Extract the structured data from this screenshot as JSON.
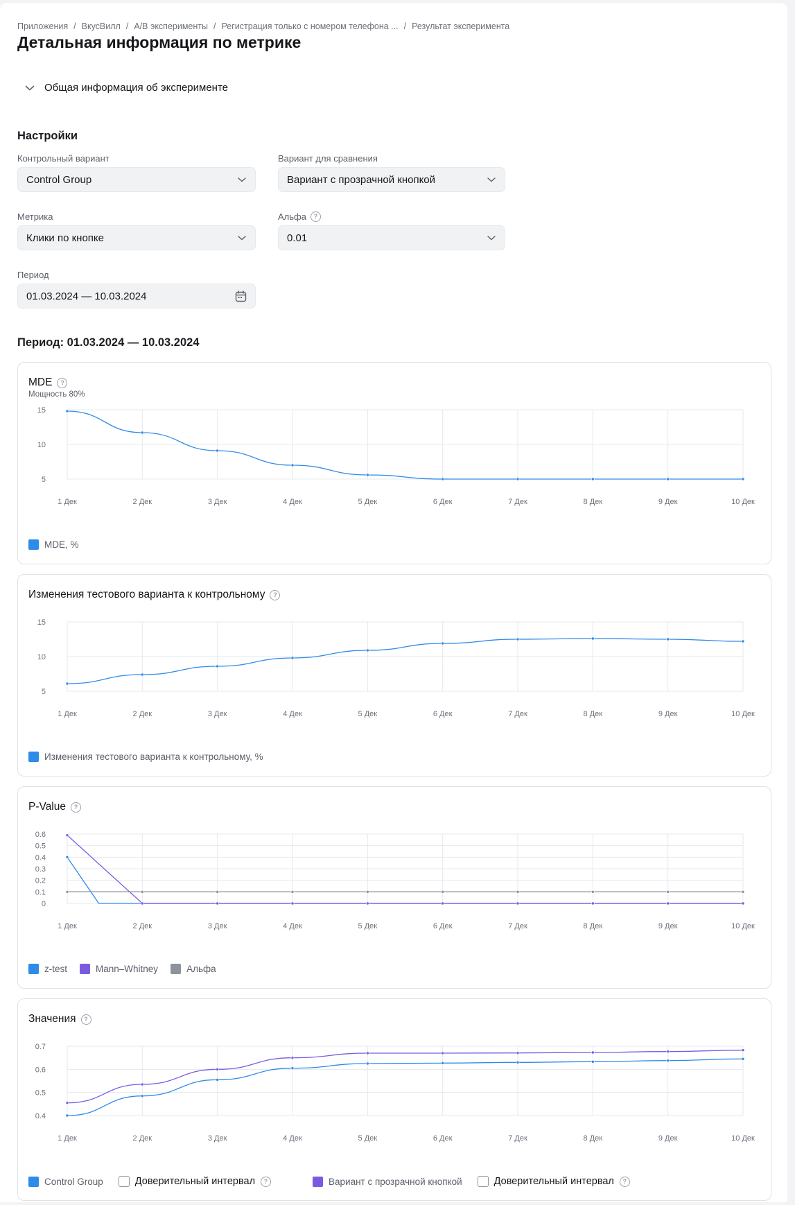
{
  "breadcrumbs": [
    "Приложения",
    "ВкусВилл",
    "A/B эксперименты",
    "Регистрация только с номером телефона ...",
    "Результат эксперимента"
  ],
  "page_title": "Детальная информация по метрике",
  "accordion_label": "Общая информация об эксперименте",
  "settings": {
    "heading": "Настройки",
    "control_label": "Контрольный вариант",
    "control_value": "Control Group",
    "compare_label": "Вариант для сравнения",
    "compare_value": "Вариант с прозрачной кнопкой",
    "metric_label": "Метрика",
    "metric_value": "Клики по кнопке",
    "alpha_label": "Альфа",
    "alpha_value": "0.01",
    "period_label": "Период",
    "period_value": "01.03.2024 — 10.03.2024"
  },
  "period_heading": "Период: 01.03.2024 — 10.03.2024",
  "colors": {
    "blue": "#2f8be8",
    "purple": "#7a5be0",
    "gray": "#8d939c",
    "grid": "#e6e8eb"
  },
  "cards": {
    "mde": {
      "title": "MDE",
      "subtitle": "Мощность 80%"
    },
    "change": {
      "title": "Изменения тестового варианта к контрольному"
    },
    "pvalue": {
      "title": "P-Value"
    },
    "values": {
      "title": "Значения"
    }
  },
  "chart_data": [
    {
      "id": "mde",
      "type": "line",
      "categories": [
        "1 Дек",
        "2 Дек",
        "3 Дек",
        "4 Дек",
        "5 Дек",
        "6 Дек",
        "7 Дек",
        "8 Дек",
        "9 Дек",
        "10 Дек"
      ],
      "ylim": [
        5,
        15
      ],
      "yticks": [
        5,
        10,
        15
      ],
      "series": [
        {
          "name": "MDE, %",
          "color": "#2f8be8",
          "values": [
            14.8,
            11.7,
            9.1,
            7.0,
            5.6,
            5.0,
            5.0,
            5.0,
            5.0,
            5.0
          ]
        }
      ],
      "grid": true,
      "legend": "bottom-left"
    },
    {
      "id": "change",
      "type": "line",
      "categories": [
        "1 Дек",
        "2 Дек",
        "3 Дек",
        "4 Дек",
        "5 Дек",
        "6 Дек",
        "7 Дек",
        "8 Дек",
        "9 Дек",
        "10 Дек"
      ],
      "ylim": [
        5,
        15
      ],
      "yticks": [
        5,
        10,
        15
      ],
      "series": [
        {
          "name": "Изменения тестового варианта к контрольному, %",
          "color": "#2f8be8",
          "values": [
            6.1,
            7.4,
            8.6,
            9.8,
            10.9,
            11.9,
            12.5,
            12.6,
            12.5,
            12.2
          ]
        }
      ],
      "grid": true,
      "legend": "bottom-left"
    },
    {
      "id": "pvalue",
      "type": "line",
      "categories": [
        "1 Дек",
        "2 Дек",
        "3 Дек",
        "4 Дек",
        "5 Дек",
        "6 Дек",
        "7 Дек",
        "8 Дек",
        "9 Дек",
        "10 Дек"
      ],
      "ylim": [
        0,
        0.6
      ],
      "yticks": [
        0,
        0.1,
        0.2,
        0.3,
        0.4,
        0.5,
        0.6
      ],
      "series": [
        {
          "name": "z-test",
          "color": "#2f8be8",
          "points": [
            [
              1,
              0.4
            ],
            [
              1.42,
              0.0
            ],
            [
              2,
              0.0
            ],
            [
              3,
              0.0
            ],
            [
              4,
              0.0
            ],
            [
              5,
              0.0
            ],
            [
              6,
              0.0
            ],
            [
              7,
              0.0
            ],
            [
              8,
              0.0
            ],
            [
              9,
              0.0
            ],
            [
              10,
              0.0
            ]
          ],
          "markers": [
            1,
            2,
            3,
            4,
            5,
            6,
            7,
            8,
            9,
            10
          ]
        },
        {
          "name": "Mann–Whitney",
          "color": "#7a5be0",
          "points": [
            [
              1,
              0.59
            ],
            [
              2,
              0.0
            ],
            [
              3,
              0.0
            ],
            [
              4,
              0.0
            ],
            [
              5,
              0.0
            ],
            [
              6,
              0.0
            ],
            [
              7,
              0.0
            ],
            [
              8,
              0.0
            ],
            [
              9,
              0.0
            ],
            [
              10,
              0.0
            ]
          ],
          "markers": [
            1,
            2,
            3,
            4,
            5,
            6,
            7,
            8,
            9,
            10
          ]
        },
        {
          "name": "Альфа",
          "color": "#8d939c",
          "points": [
            [
              1,
              0.1
            ],
            [
              2,
              0.1
            ],
            [
              3,
              0.1
            ],
            [
              4,
              0.1
            ],
            [
              5,
              0.1
            ],
            [
              6,
              0.1
            ],
            [
              7,
              0.1
            ],
            [
              8,
              0.1
            ],
            [
              9,
              0.1
            ],
            [
              10,
              0.1
            ]
          ],
          "markers": [
            1,
            2,
            3,
            4,
            5,
            6,
            7,
            8,
            9,
            10
          ]
        }
      ],
      "grid": true,
      "legend": "bottom-left"
    },
    {
      "id": "values",
      "type": "line",
      "categories": [
        "1 Дек",
        "2 Дек",
        "3 Дек",
        "4 Дек",
        "5 Дек",
        "6 Дек",
        "7 Дек",
        "8 Дек",
        "9 Дек",
        "10 Дек"
      ],
      "ylim": [
        0.4,
        0.7
      ],
      "yticks": [
        0.4,
        0.5,
        0.6,
        0.7
      ],
      "series": [
        {
          "name": "Control Group",
          "color": "#2f8be8",
          "values": [
            0.4,
            0.485,
            0.555,
            0.605,
            0.625,
            0.627,
            0.63,
            0.633,
            0.638,
            0.645
          ]
        },
        {
          "name": "Вариант с прозрачной кнопкой",
          "color": "#7a5be0",
          "values": [
            0.455,
            0.535,
            0.6,
            0.65,
            0.67,
            0.67,
            0.671,
            0.673,
            0.677,
            0.683
          ]
        }
      ],
      "grid": true,
      "legend": "bottom-left",
      "legend_extra": "Доверительный интервал"
    }
  ]
}
